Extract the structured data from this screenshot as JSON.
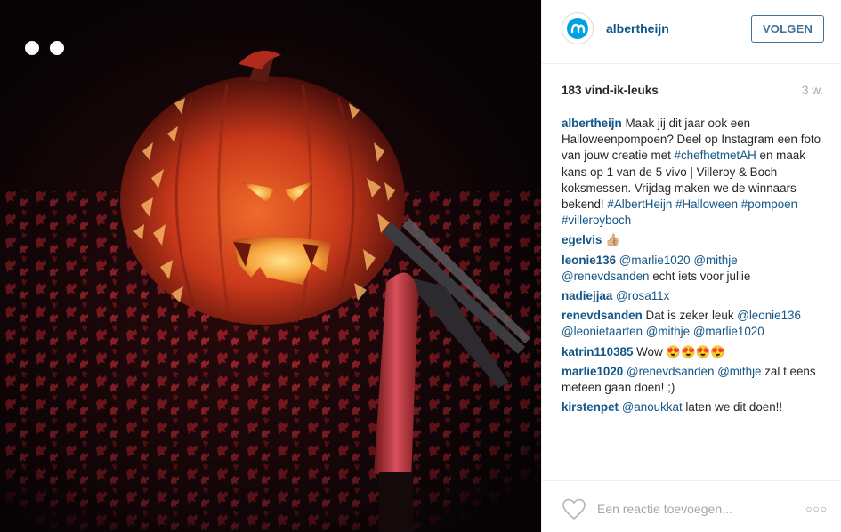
{
  "post": {
    "image_alt": "Uitgesneden halloweenpompoen met messen",
    "username": "albertheijn",
    "follow_label": "VOLGEN",
    "likes": "183 vind-ik-leuks",
    "time_ago": "3 w.",
    "icons": {
      "avatar": "albert-heijn-logo",
      "like": "heart-outline-icon",
      "more": "more-options-icon"
    },
    "colors": {
      "link": "#125688",
      "follow": "#3f729b",
      "muted": "#a5a7aa"
    }
  },
  "comments": [
    {
      "user": "albertheijn",
      "parts": [
        {
          "t": "text",
          "v": "Maak jij dit jaar ook een Halloweenpompoen? Deel op Instagram een foto van jouw creatie met "
        },
        {
          "t": "link",
          "v": "#chefhetmetAH"
        },
        {
          "t": "text",
          "v": " en maak kans op 1 van de 5 vivo | Villeroy & Boch koksmessen. Vrijdag maken we de winnaars bekend! "
        },
        {
          "t": "link",
          "v": "#AlbertHeijn"
        },
        {
          "t": "text",
          "v": " "
        },
        {
          "t": "link",
          "v": "#Halloween"
        },
        {
          "t": "text",
          "v": " "
        },
        {
          "t": "link",
          "v": "#pompoen"
        },
        {
          "t": "text",
          "v": " "
        },
        {
          "t": "link",
          "v": "#villeroyboch"
        }
      ]
    },
    {
      "user": "egelvis",
      "parts": [
        {
          "t": "text",
          "v": "👍🏼"
        }
      ]
    },
    {
      "user": "leonie136",
      "parts": [
        {
          "t": "link",
          "v": "@marlie1020"
        },
        {
          "t": "text",
          "v": " "
        },
        {
          "t": "link",
          "v": "@mithje"
        },
        {
          "t": "text",
          "v": " "
        },
        {
          "t": "link",
          "v": "@renevdsanden"
        },
        {
          "t": "text",
          "v": " echt iets voor jullie"
        }
      ]
    },
    {
      "user": "nadiejjaa",
      "parts": [
        {
          "t": "link",
          "v": "@rosa11x"
        }
      ]
    },
    {
      "user": "renevdsanden",
      "parts": [
        {
          "t": "text",
          "v": "Dat is zeker leuk "
        },
        {
          "t": "link",
          "v": "@leonie136"
        },
        {
          "t": "text",
          "v": " "
        },
        {
          "t": "link",
          "v": "@leonietaarten"
        },
        {
          "t": "text",
          "v": " "
        },
        {
          "t": "link",
          "v": "@mithje"
        },
        {
          "t": "text",
          "v": " "
        },
        {
          "t": "link",
          "v": "@marlie1020"
        }
      ]
    },
    {
      "user": "katrin110385",
      "parts": [
        {
          "t": "text",
          "v": "Wow 😍😍😍😍"
        }
      ]
    },
    {
      "user": "marlie1020",
      "parts": [
        {
          "t": "link",
          "v": "@renevdsanden"
        },
        {
          "t": "text",
          "v": " "
        },
        {
          "t": "link",
          "v": "@mithje"
        },
        {
          "t": "text",
          "v": " zal t eens meteen gaan doen! ;)"
        }
      ]
    },
    {
      "user": "kirstenpet",
      "parts": [
        {
          "t": "link",
          "v": "@anoukkat"
        },
        {
          "t": "text",
          "v": " laten we dit doen!!"
        }
      ]
    }
  ],
  "footer": {
    "comment_placeholder": "Een reactie toevoegen...",
    "more_label": "○○○"
  }
}
